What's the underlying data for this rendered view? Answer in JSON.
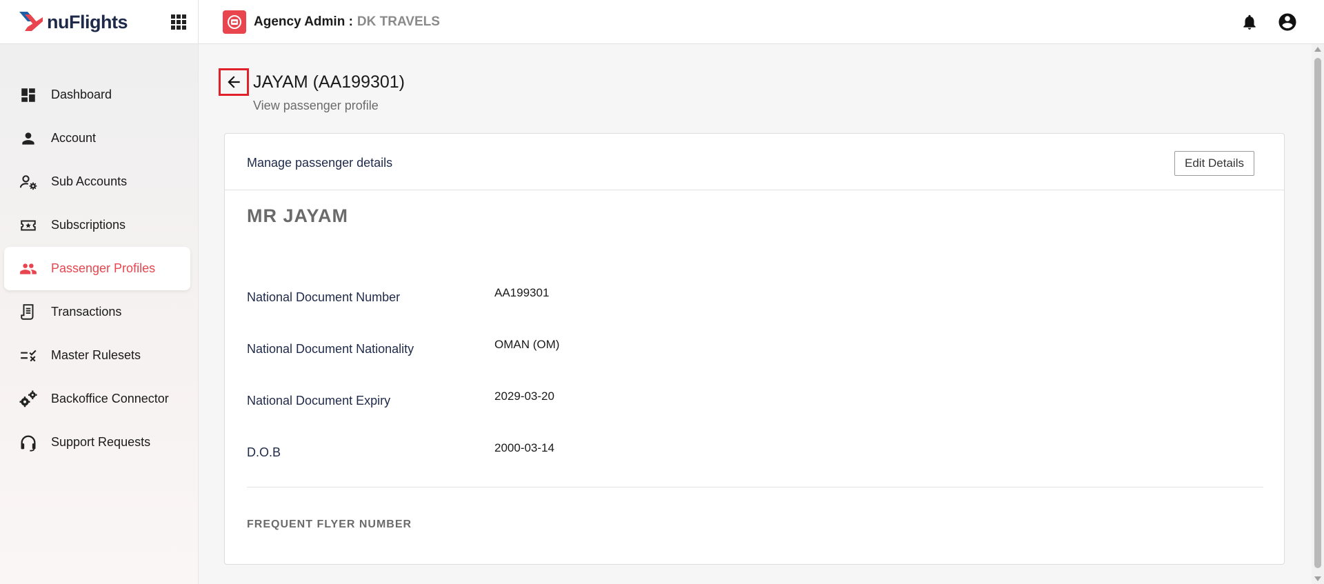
{
  "app": {
    "brand_name": "nuFlights",
    "agency_label": "Agency Admin :",
    "agency_name": "DK TRAVELS",
    "accent_color": "#e8454e"
  },
  "sidebar": {
    "items": [
      {
        "label": "Dashboard",
        "icon": "dashboard-icon",
        "active": false
      },
      {
        "label": "Account",
        "icon": "person-icon",
        "active": false
      },
      {
        "label": "Sub Accounts",
        "icon": "user-gear-icon",
        "active": false
      },
      {
        "label": "Subscriptions",
        "icon": "ticket-star-icon",
        "active": false
      },
      {
        "label": "Passenger Profiles",
        "icon": "people-icon",
        "active": true
      },
      {
        "label": "Transactions",
        "icon": "receipt-icon",
        "active": false
      },
      {
        "label": "Master Rulesets",
        "icon": "checklist-icon",
        "active": false
      },
      {
        "label": "Backoffice Connector",
        "icon": "gears-icon",
        "active": false
      },
      {
        "label": "Support Requests",
        "icon": "headset-icon",
        "active": false
      }
    ]
  },
  "page": {
    "title": "JAYAM (AA199301)",
    "subtitle": "View passenger profile"
  },
  "card": {
    "header_title": "Manage passenger details",
    "edit_label": "Edit Details",
    "passenger_name": "MR JAYAM",
    "details": [
      {
        "label": "National Document Number",
        "value": "AA199301"
      },
      {
        "label": "National Document Nationality",
        "value": "OMAN (OM)"
      },
      {
        "label": "National Document Expiry",
        "value": "2029-03-20"
      },
      {
        "label": "D.O.B",
        "value": "2000-03-14"
      }
    ],
    "frequent_flyer_heading": "FREQUENT FLYER NUMBER"
  }
}
